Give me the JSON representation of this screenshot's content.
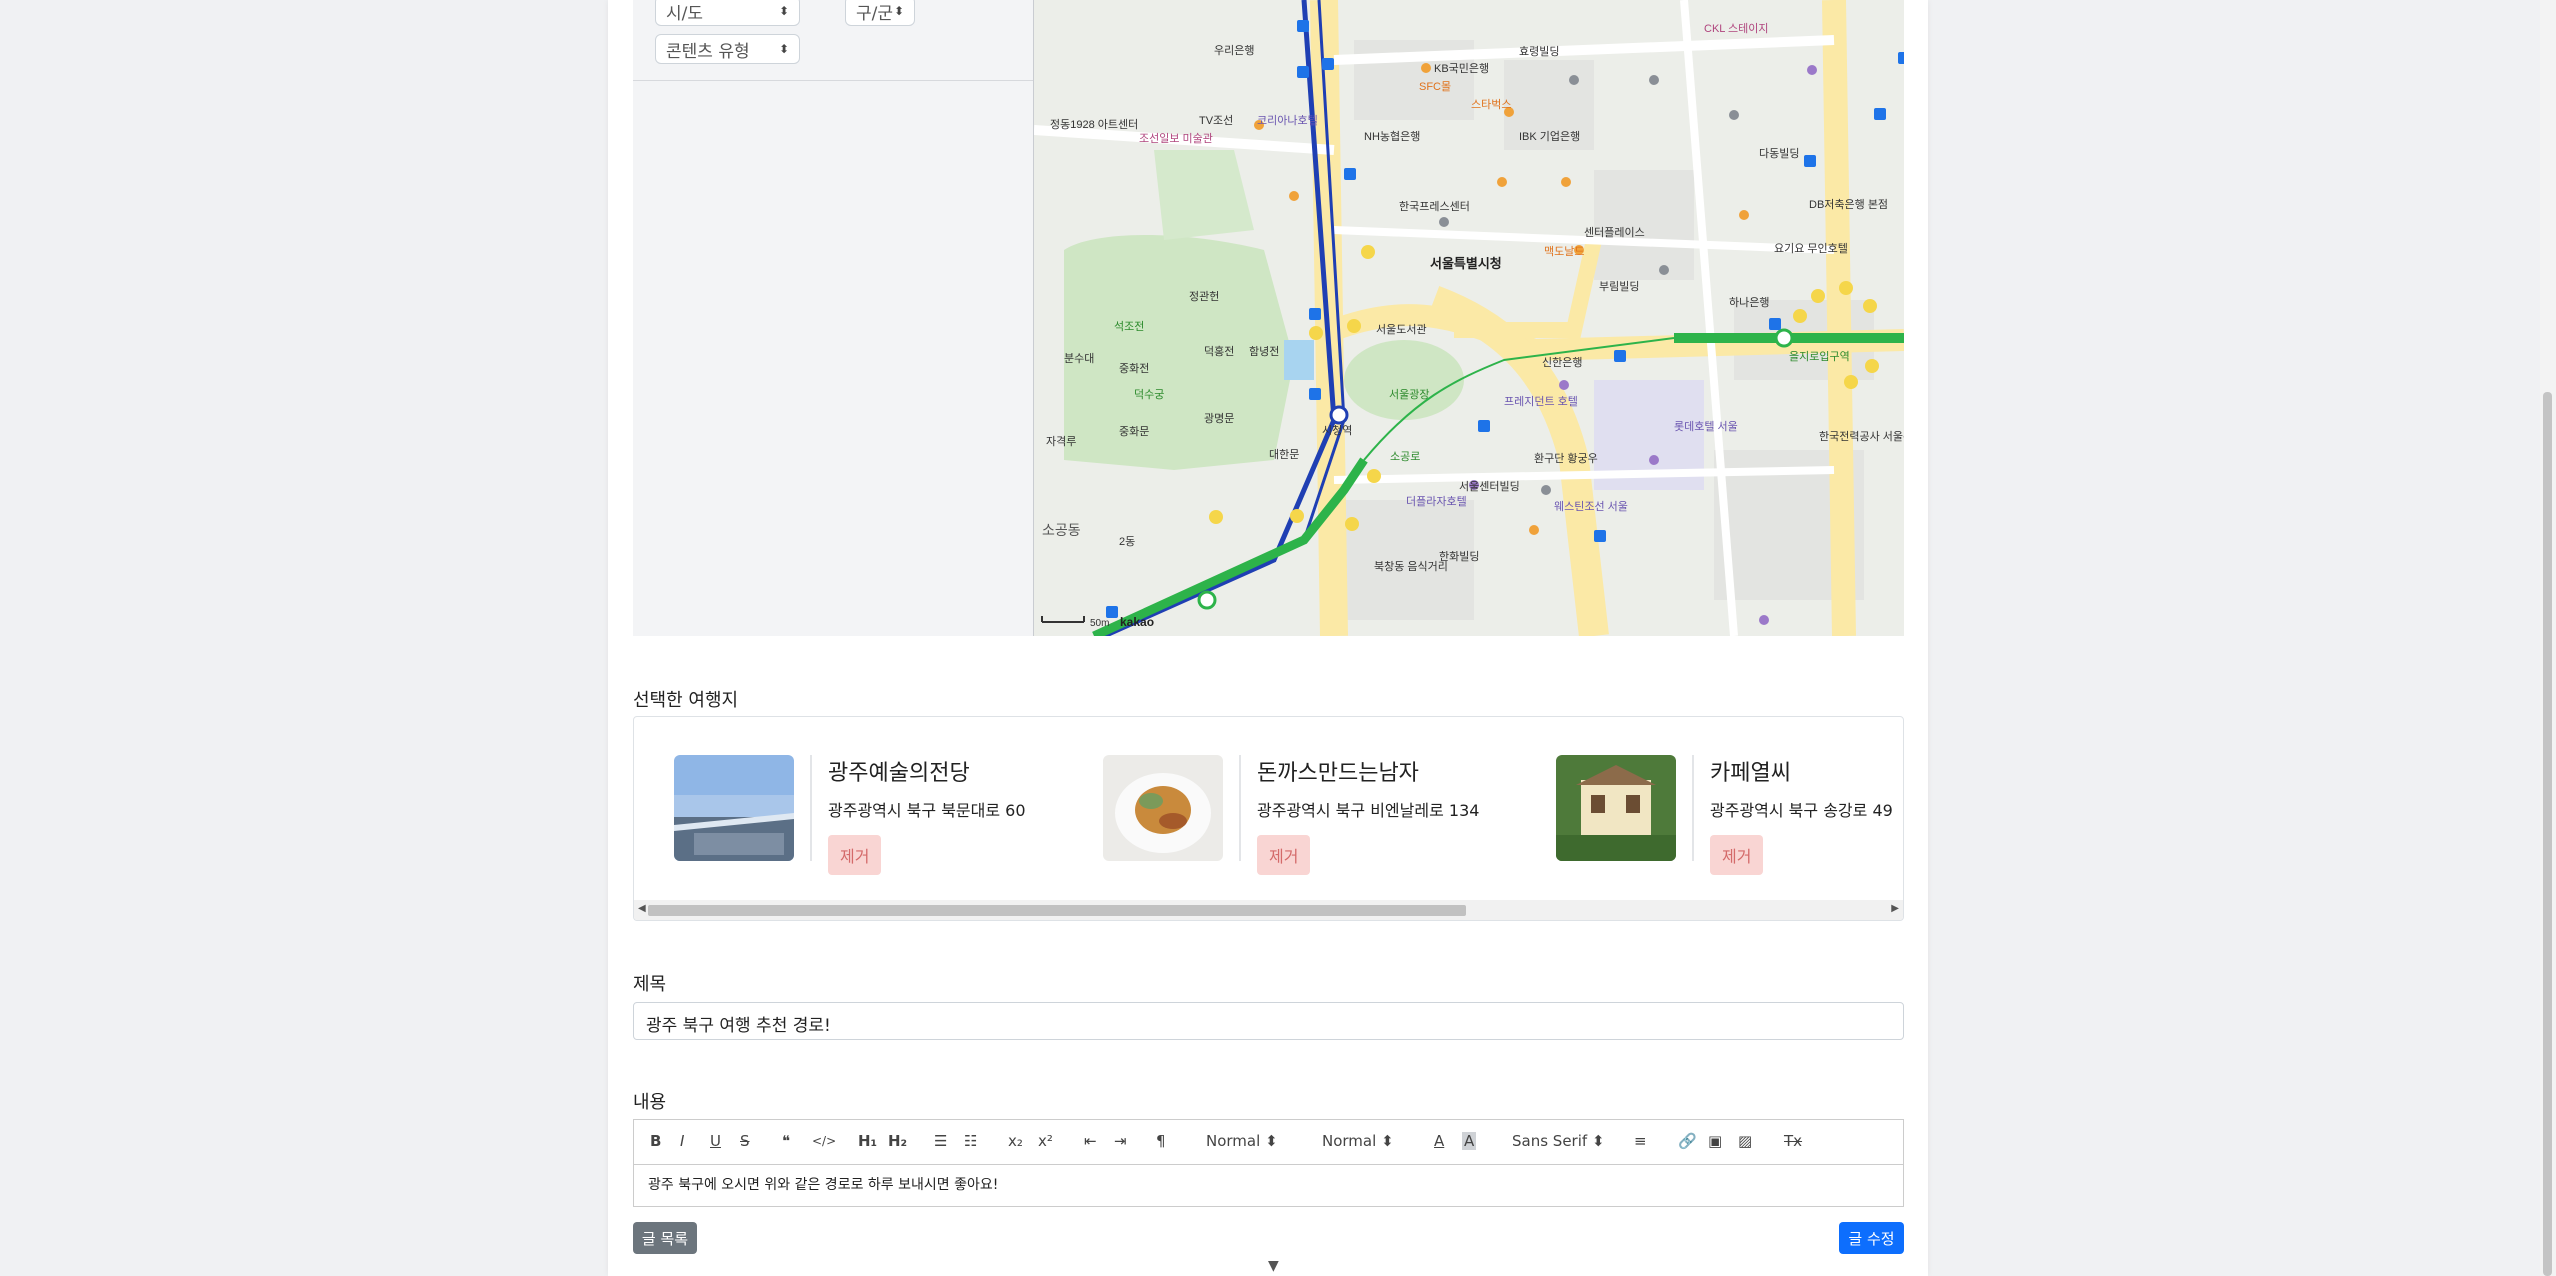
{
  "filters": {
    "province": "시/도",
    "district": "구/군",
    "content_type": "콘텐츠 유형"
  },
  "map": {
    "labels": {
      "city_hall": "서울특별시청",
      "library": "서울도서관",
      "square": "서울광장",
      "deoksugung": "덕수궁",
      "seokjojeon": "석조전",
      "jeonggwanheon": "정관헌",
      "junghwajeon": "중화전",
      "hamnyeongjeon": "함녕전",
      "deokhongjeon": "덕홍전",
      "junghwamun": "중화문",
      "gwangmyeongmun": "광명문",
      "jagyeongnu": "자격루",
      "bunsudae": "분수대",
      "daehanmun": "대한문",
      "korea_press": "한국프레스센터",
      "lotte_hotel": "롯데호텔 서울",
      "plaza_hotel": "더플라자호텔",
      "sogong": "소공동",
      "sogongro": "소공로",
      "euljiro_entrance": "을지로입구역",
      "city_hall_stn": "시청역",
      "station_2": "2동",
      "kepco": "한국전력공사 서울본부",
      "westin": "웨스틴조선 서울",
      "bukchang": "북창동 음식거리",
      "seoul_center_bldg": "서울센터빌딩",
      "prince_hotel": "프레지던트 호텔",
      "hwangudan": "환구단 황궁우",
      "shinhan": "신한은행",
      "hanwha": "한화빌딩",
      "ibk": "IBK 기업은행",
      "nh": "NH농협은행",
      "kb": "KB국민은행",
      "hyoryeong": "효령빌딩",
      "sfc": "SFC몰",
      "starbucks": "스타벅스",
      "mcdonalds": "맥도날드",
      "buryeong": "부림빌딩",
      "centre_place": "센터플레이스",
      "db_insurance": "DB저축은행 본점",
      "dada": "다동빌딩",
      "hana": "하나은행",
      "yogiyo": "요기요 무인호텔",
      "jungmyeongjeon": "정동1928 아트센터",
      "chosun_museum": "조선일보 미술관",
      "tv_chosun": "TV조선",
      "coreana": "코리아나호텔",
      "uri_bank": "우리은행",
      "cgv": "CKL 스테이지",
      "kakao_logo": "kakao",
      "scale": "50m"
    }
  },
  "selected": {
    "label": "선택한 여행지",
    "items": [
      {
        "name": "광주예술의전당",
        "address": "광주광역시 북구 북문대로 60",
        "remove_label": "제거"
      },
      {
        "name": "돈까스만드는남자",
        "address": "광주광역시 북구 비엔날레로 134",
        "remove_label": "제거"
      },
      {
        "name": "카페열씨",
        "address": "광주광역시 북구 송강로 49",
        "remove_label": "제거"
      }
    ]
  },
  "title": {
    "label": "제목",
    "value": "광주 북구 여행 추천 경로!"
  },
  "content": {
    "label": "내용",
    "toolbar": {
      "header_select": "Normal",
      "size_select": "Normal",
      "font_select": "Sans Serif",
      "bold": "B",
      "italic": "I",
      "underline": "U",
      "strike": "S",
      "quote": "❝",
      "code": "</>",
      "h1": "H₁",
      "h2": "H₂",
      "sub": "x₂",
      "sup": "x²",
      "rtl": "¶",
      "color": "A",
      "background": "A",
      "clean": "Tx"
    },
    "text": "광주 북구에 오시면 위와 같은 경로로 하루 보내시면 좋아요!"
  },
  "buttons": {
    "list": "글 목록",
    "edit": "글 수정"
  },
  "colors": {
    "remove_bg": "#f9d5d3",
    "remove_text": "#d46a6a",
    "primary": "#0d6efd",
    "secondary": "#6c757d",
    "subway_line1": "#1f3fb3",
    "subway_line2": "#2db34a",
    "road": "#fbe9a6"
  }
}
